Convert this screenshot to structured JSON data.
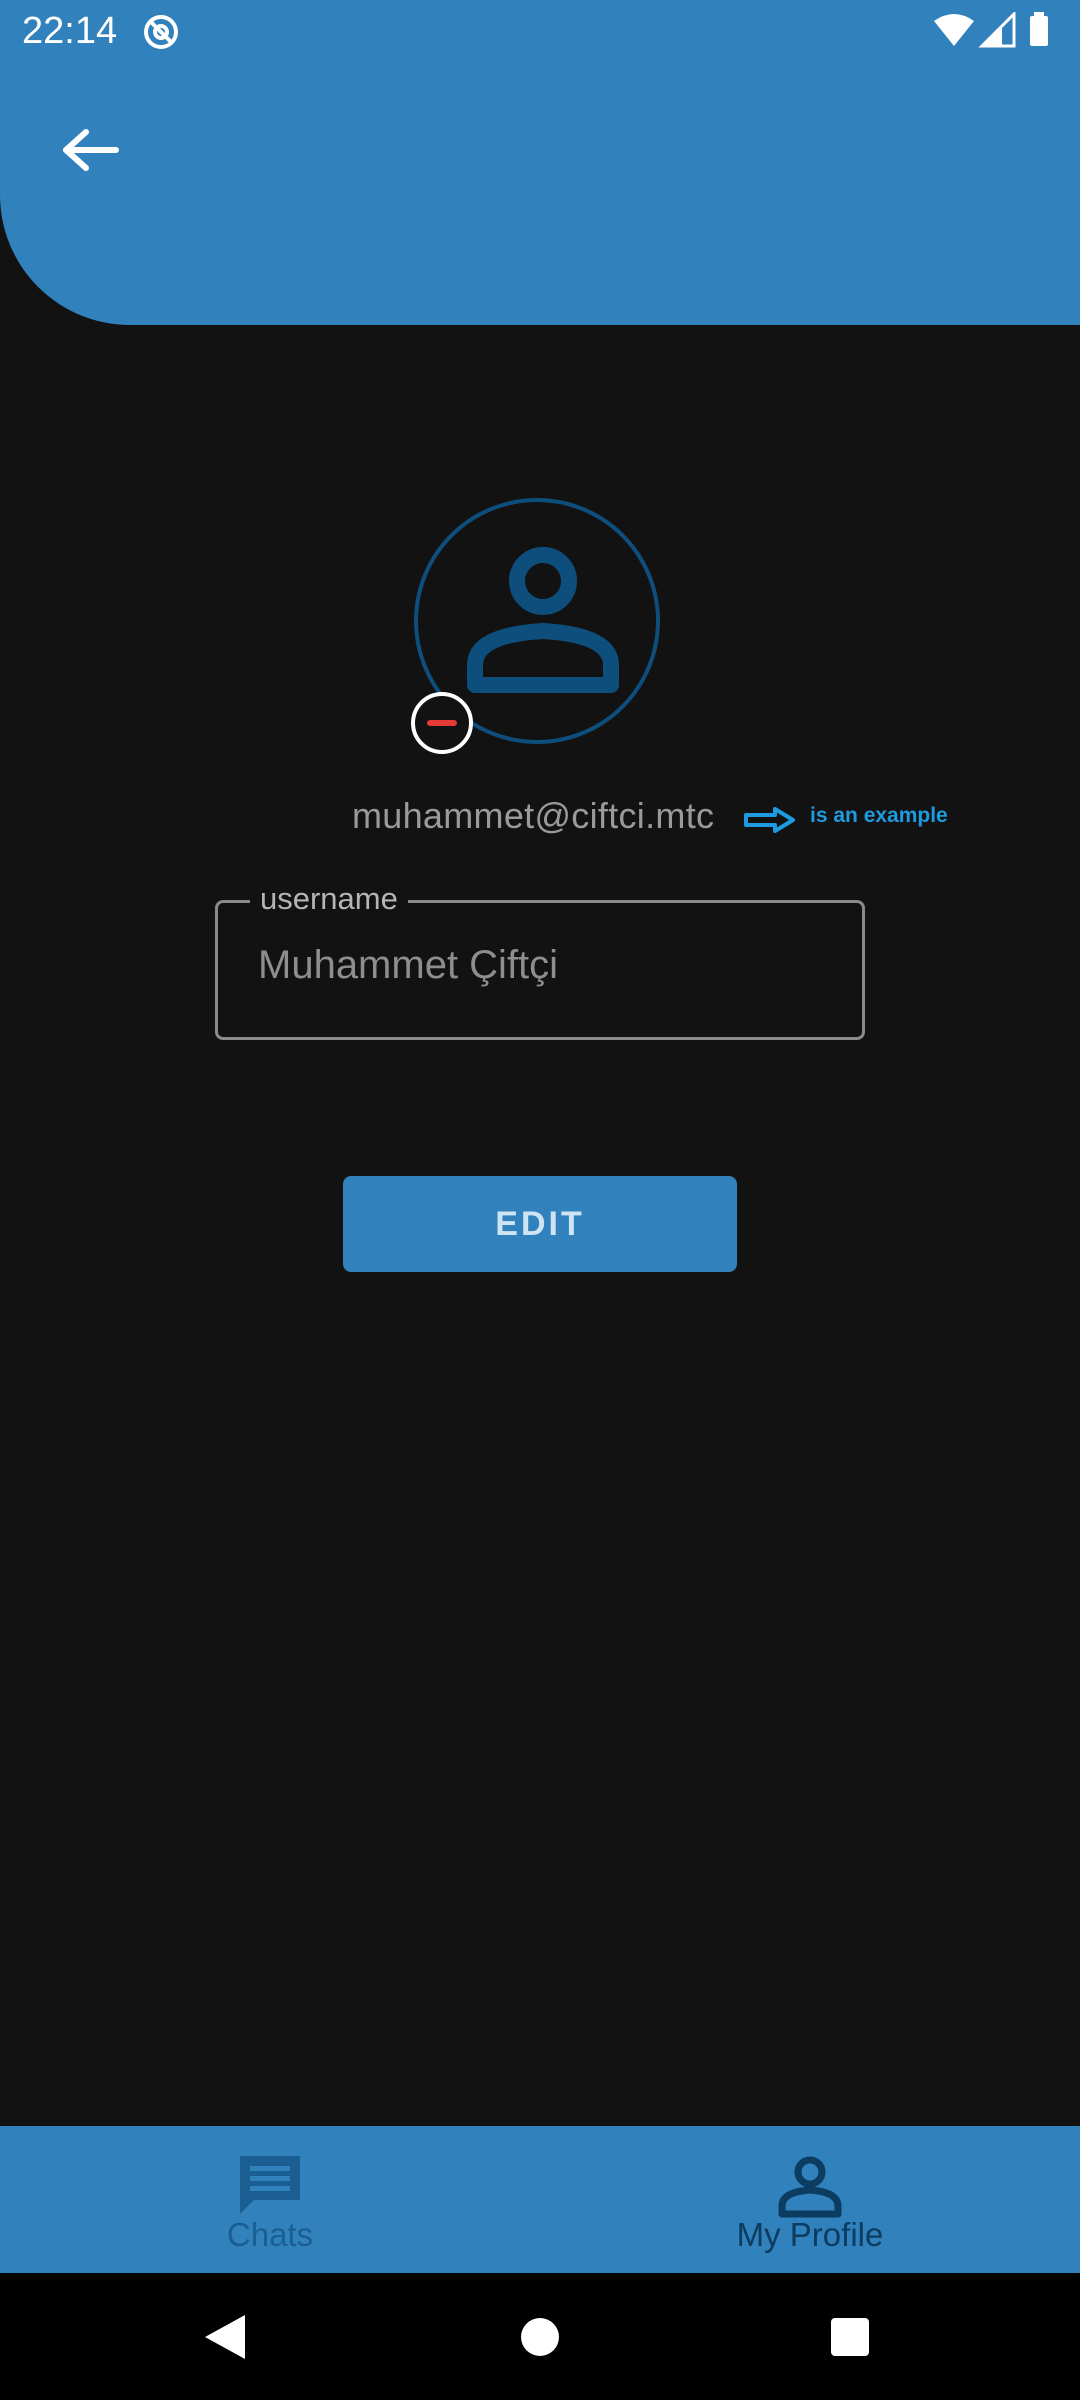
{
  "status_bar": {
    "time": "22:14",
    "left_icon": "sync-disabled-icon",
    "right_icons": [
      "wifi-icon",
      "cell-signal-icon",
      "battery-icon"
    ]
  },
  "header": {
    "back_icon": "arrow-left-icon"
  },
  "profile": {
    "avatar_icon": "person-icon",
    "remove_photo_icon": "minus-circle-icon",
    "email": "muhammet@ciftci.mtc",
    "example_arrow_icon": "arrow-right-outline-icon",
    "example_note": "is an example"
  },
  "username_field": {
    "label": "username",
    "value": "Muhammet Çiftçi"
  },
  "edit_button": {
    "label": "EDIT"
  },
  "bottom_nav": {
    "items": [
      {
        "label": "Chats",
        "icon": "chat-icon",
        "active": false
      },
      {
        "label": "My Profile",
        "icon": "person-icon",
        "active": true
      }
    ]
  },
  "system_nav": {
    "buttons": [
      "back-triangle-icon",
      "home-circle-icon",
      "recents-square-icon"
    ]
  },
  "colors": {
    "primary": "#3181bc",
    "background": "#121212",
    "avatar_outline": "#0e4e7d",
    "remove_accent": "#e53935",
    "example_note": "#1e9be0"
  }
}
